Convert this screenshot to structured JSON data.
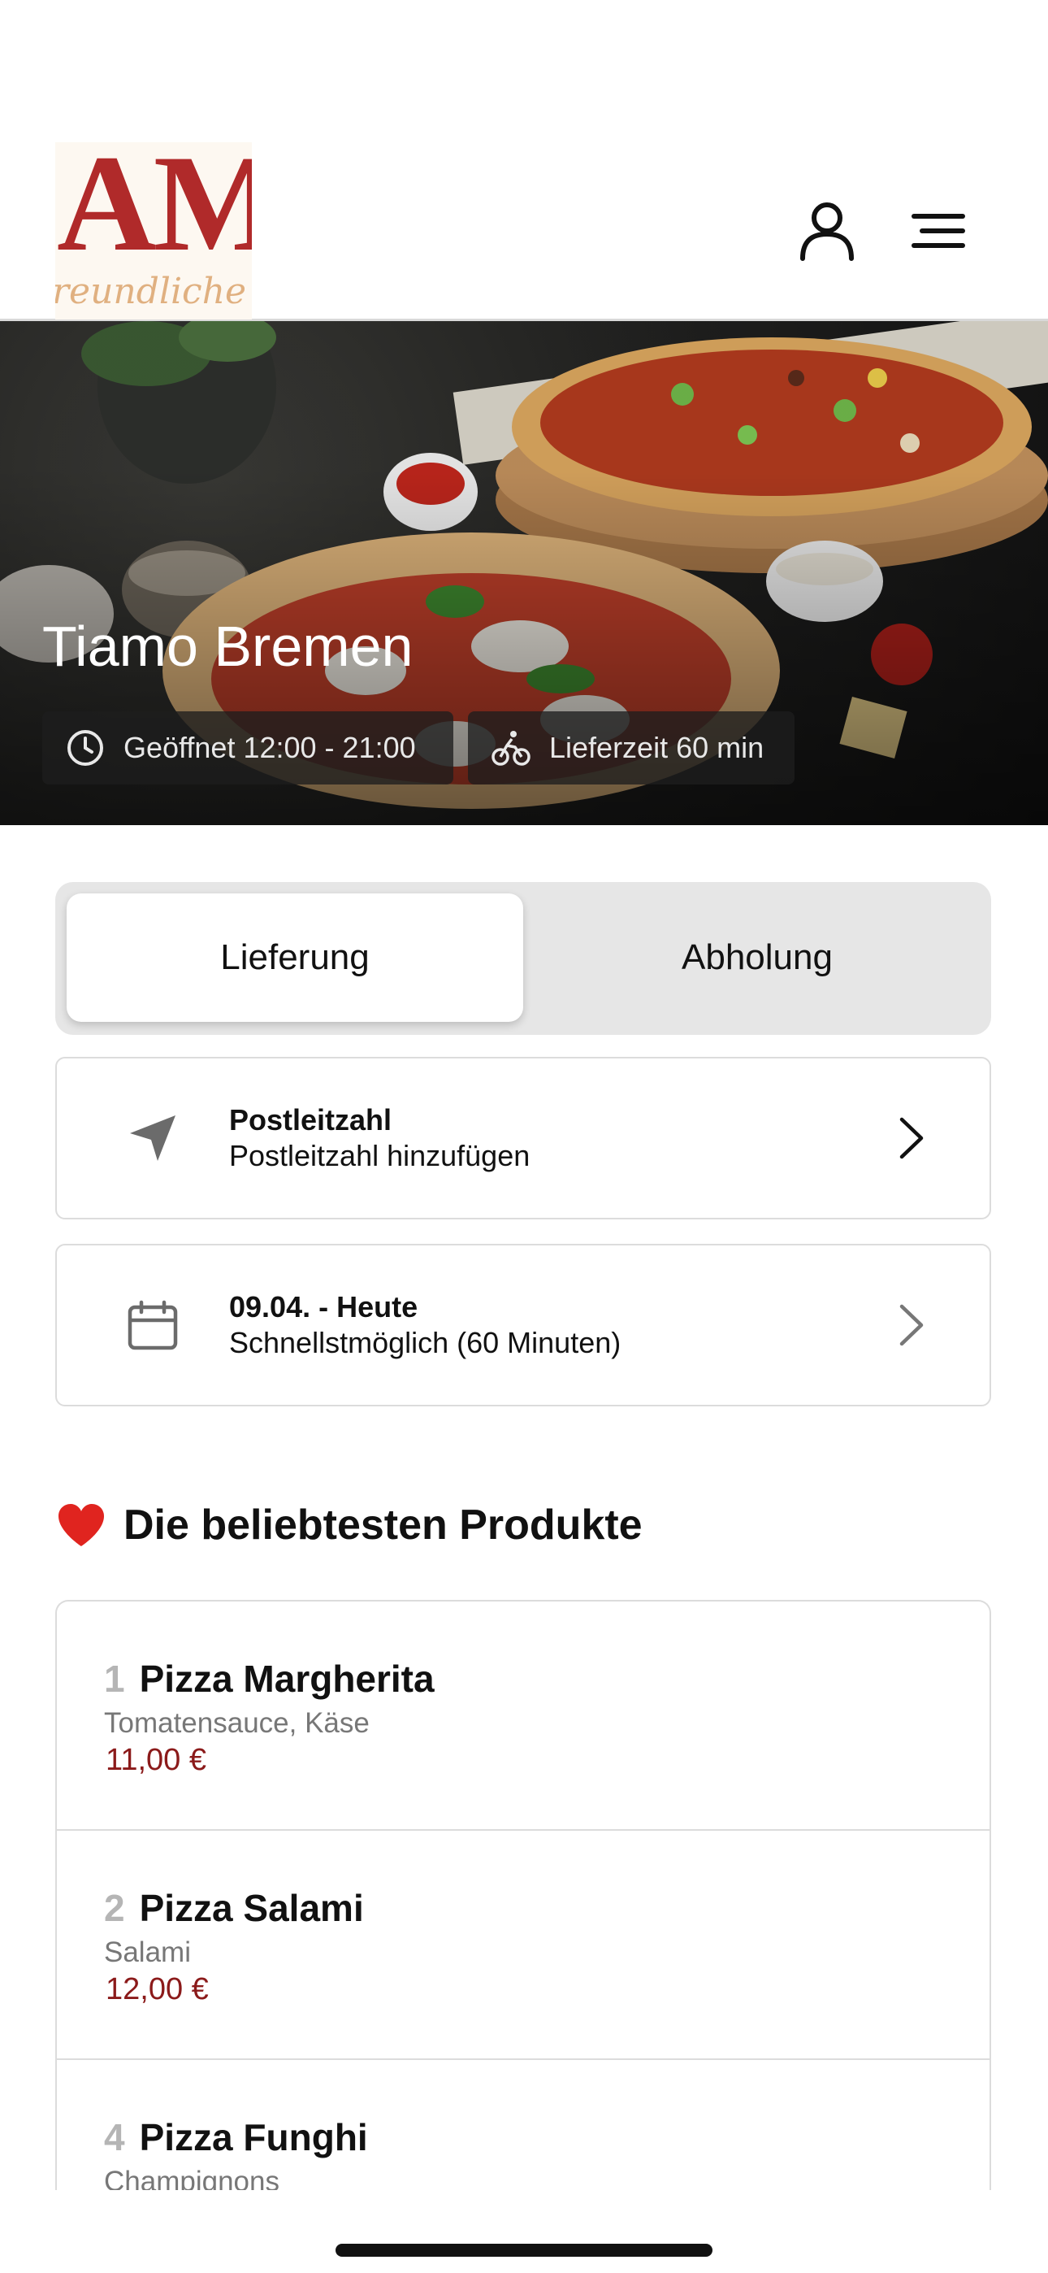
{
  "header": {
    "logo": {
      "text": "AM",
      "tagline": "reundliche"
    },
    "icons": {
      "profile": "person-icon",
      "menu": "hamburger-menu-icon"
    }
  },
  "hero": {
    "title": "Tiamo Bremen",
    "opening_hours": "Geöffnet 12:00 - 21:00",
    "delivery_time": "Lieferzeit 60 min",
    "icons": {
      "hours": "clock-icon",
      "delivery": "bicycle-icon"
    }
  },
  "order_mode": {
    "options": [
      "Lieferung",
      "Abholung"
    ],
    "selected": "Lieferung"
  },
  "postcode_card": {
    "title": "Postleitzahl",
    "subtitle": "Postleitzahl hinzufügen",
    "icon": "location-arrow-icon"
  },
  "date_card": {
    "title": "09.04. - Heute",
    "subtitle": "Schnellstmöglich (60 Minuten)",
    "icon": "calendar-icon"
  },
  "popular": {
    "emoji": "❤️",
    "title": "Die beliebtesten Produkte",
    "items": [
      {
        "rank": "1",
        "name": "Pizza Margherita",
        "description": "Tomatensauce, Käse",
        "price": "11,00 €"
      },
      {
        "rank": "2",
        "name": "Pizza Salami",
        "description": "Salami",
        "price": "12,00 €"
      },
      {
        "rank": "4",
        "name": "Pizza Funghi",
        "description": "Champignons",
        "price": ""
      }
    ]
  },
  "colors": {
    "price": "#8b1a1a",
    "logo": "#b02a2a",
    "toggle_bg": "#e6e6e6"
  }
}
